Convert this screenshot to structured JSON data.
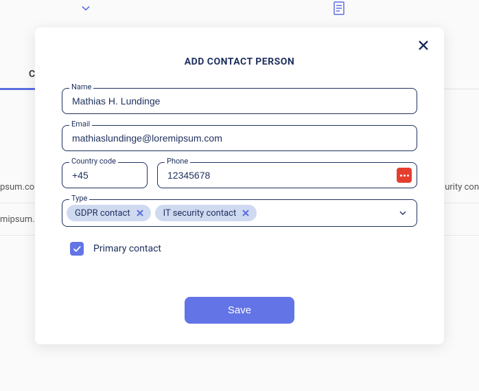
{
  "background": {
    "tab_letter": "C",
    "row_text_left_1": "psum.co",
    "row_text_right_1": "urity con",
    "row_text_left_2": "mipsum.co"
  },
  "modal": {
    "title": "ADD CONTACT PERSON",
    "fields": {
      "name": {
        "label": "Name",
        "value": "Mathias H. Lundinge"
      },
      "email": {
        "label": "Email",
        "value": "mathiaslundinge@loremipsum.com"
      },
      "country_code": {
        "label": "Country code",
        "value": "+45"
      },
      "phone": {
        "label": "Phone",
        "value": "12345678"
      },
      "type": {
        "label": "Type",
        "tags": [
          "GDPR contact",
          "IT security contact"
        ]
      }
    },
    "primary_checkbox": {
      "label": "Primary contact",
      "checked": true
    },
    "save_button": "Save"
  }
}
